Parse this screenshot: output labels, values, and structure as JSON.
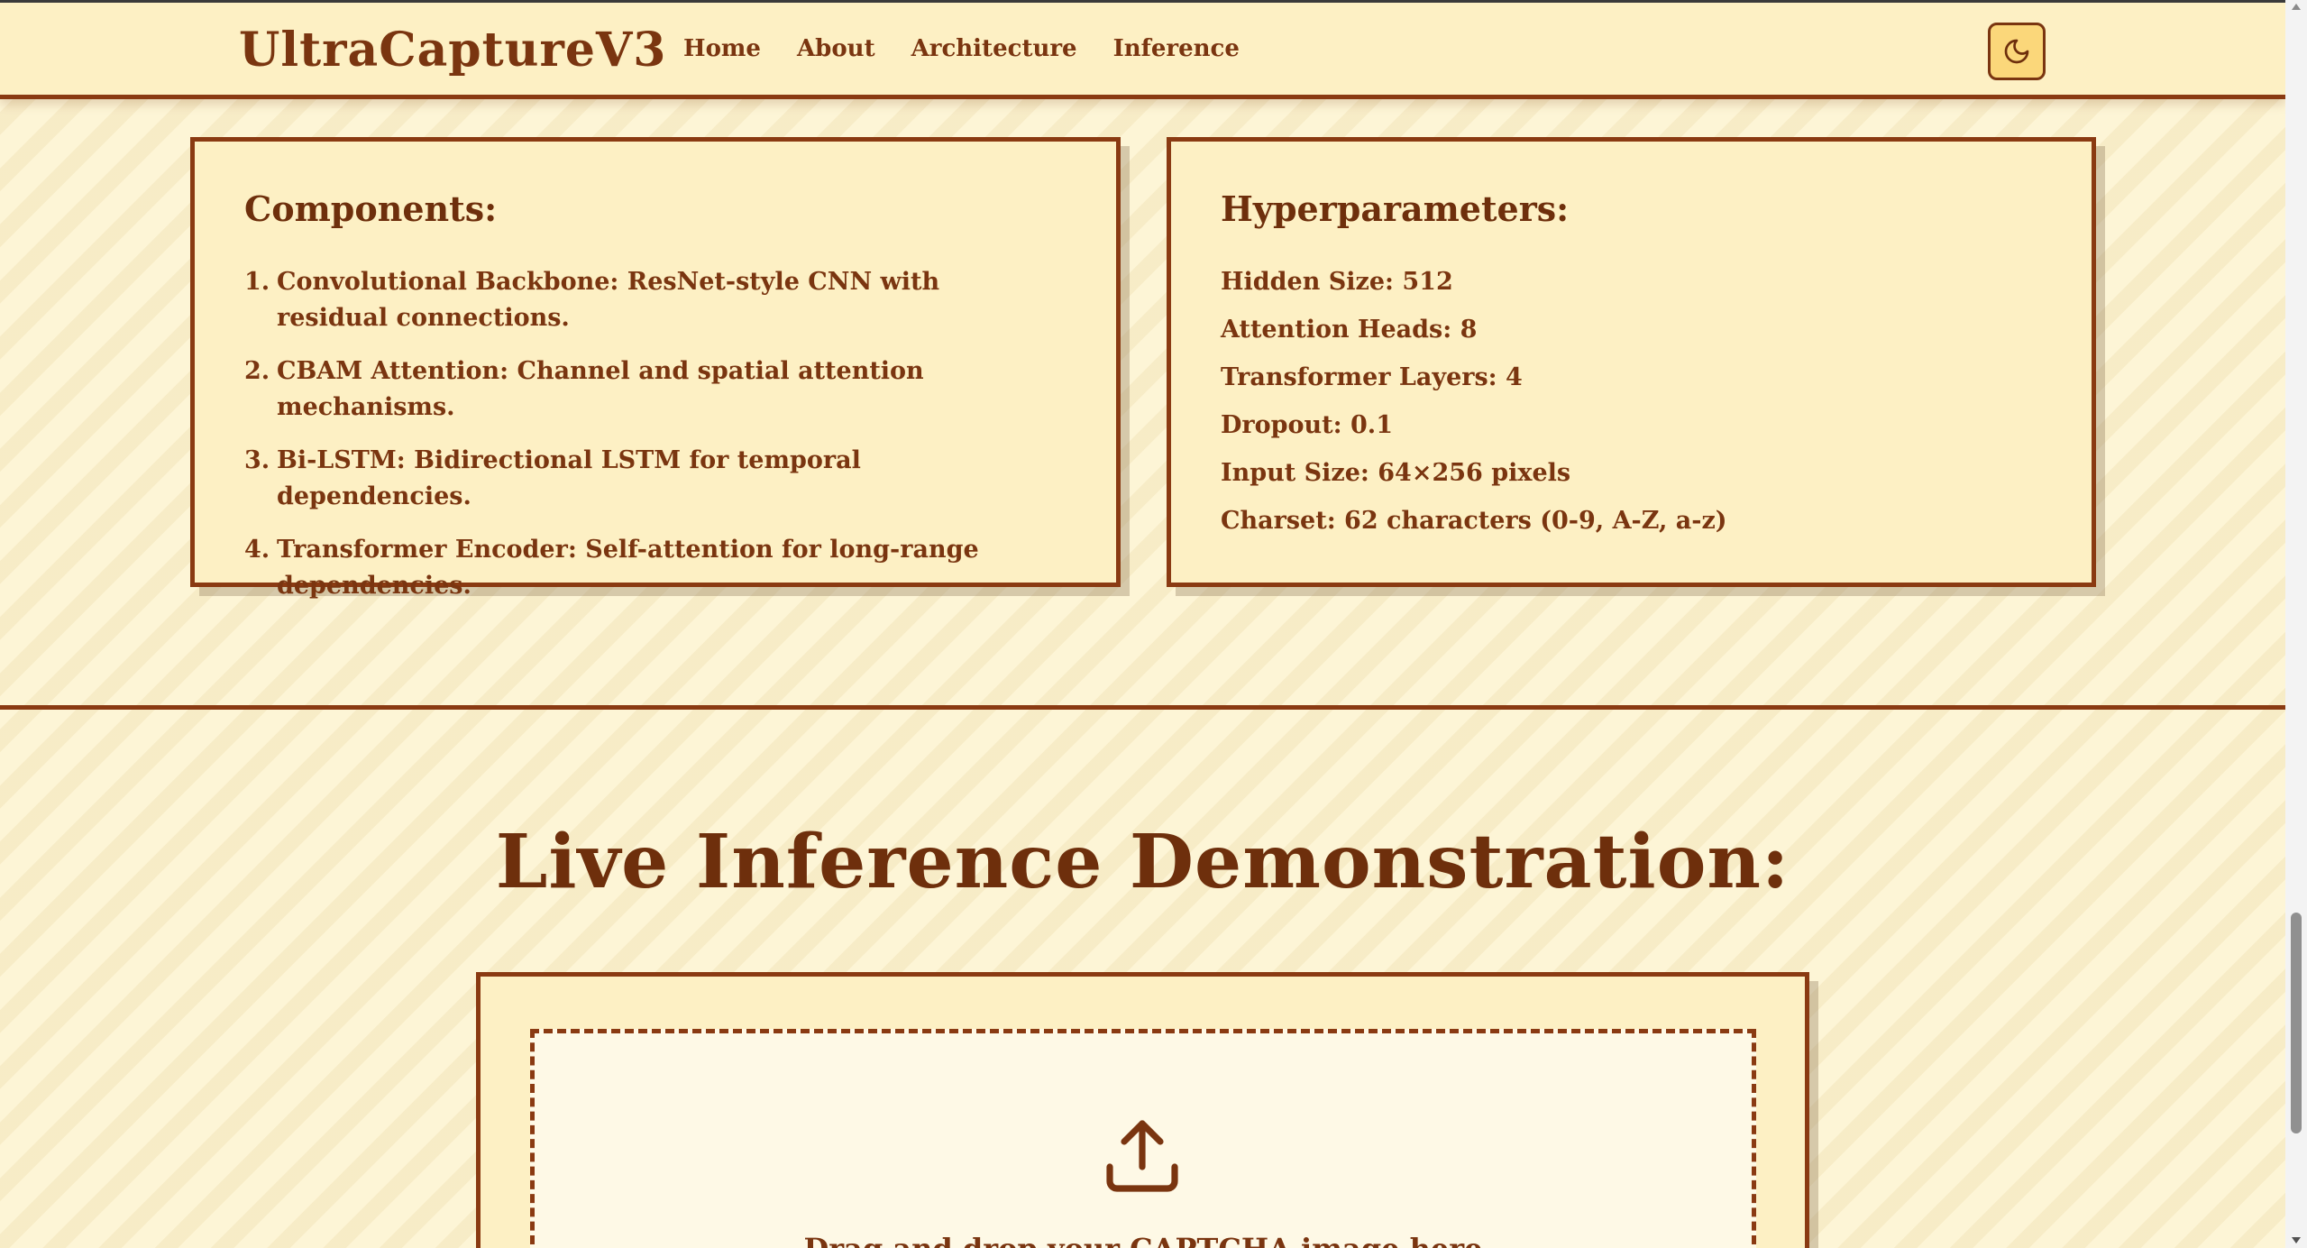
{
  "navbar": {
    "brand": "UltraCaptureV3",
    "links": [
      "Home",
      "About",
      "Architecture",
      "Inference"
    ],
    "theme_toggle_icon": "moon-icon"
  },
  "components": {
    "title": "Components:",
    "items": [
      {
        "num": "1.",
        "text": "Convolutional Backbone: ResNet-style CNN with residual connections."
      },
      {
        "num": "2.",
        "text": "CBAM Attention: Channel and spatial attention mechanisms."
      },
      {
        "num": "3.",
        "text": "Bi-LSTM: Bidirectional LSTM for temporal dependencies."
      },
      {
        "num": "4.",
        "text": "Transformer Encoder: Self-attention for long-range dependencies."
      }
    ]
  },
  "hyperparameters": {
    "title": "Hyperparameters:",
    "items": [
      "Hidden Size: 512",
      "Attention Heads: 8",
      "Transformer Layers: 4",
      "Dropout: 0.1",
      "Input Size: 64×256 pixels",
      "Charset: 62 characters (0-9, A-Z, a-z)"
    ]
  },
  "inference": {
    "title": "Live Inference Demonstration:",
    "upload_icon": "upload-icon",
    "drop_text": "Drag and drop your CAPTCHA image here"
  },
  "colors": {
    "accent": "#8a3a12",
    "text": "#7a3510",
    "card_bg": "#fdf0c4",
    "page_bg": "#fdf5d6",
    "toggle_bg": "#fbd77a"
  }
}
